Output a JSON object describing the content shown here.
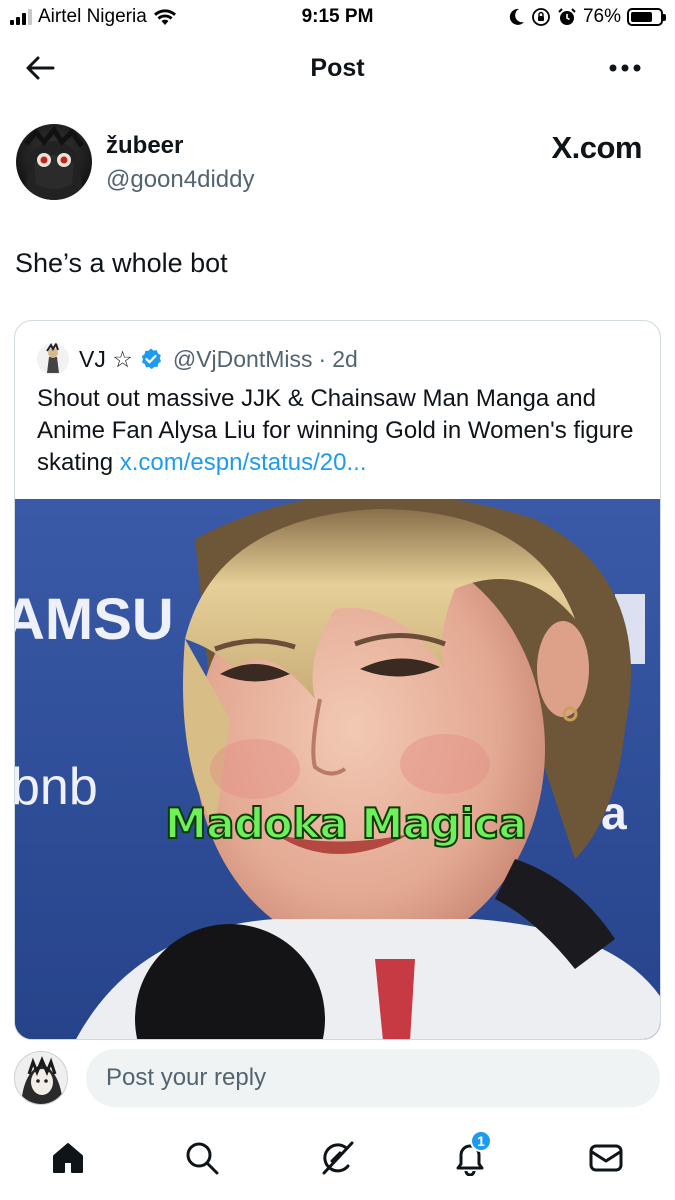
{
  "status_bar": {
    "carrier": "Airtel Nigeria",
    "time": "9:15 PM",
    "battery_percent": "76%",
    "battery_level": 0.76
  },
  "header": {
    "title": "Post"
  },
  "post": {
    "author_name": "žubeer",
    "author_handle": "@goon4diddy",
    "source_label": "X.com",
    "text": "She’s a whole bot"
  },
  "quote": {
    "name": "VJ ☆",
    "handle": "@VjDontMiss",
    "separator": "·",
    "age": "2d",
    "text": "Shout out massive JJK & Chainsaw Man Manga and Anime Fan Alysa Liu for winning Gold in Women's figure skating ",
    "link": "x.com/espn/status/20...",
    "media": {
      "caption": "Madoka Magica",
      "backdrop_words": [
        "AMSU",
        "bnb",
        "ba"
      ]
    }
  },
  "reply": {
    "placeholder": "Post your reply"
  },
  "tab_bar": {
    "notifications_badge": "1"
  },
  "colors": {
    "accent": "#1d9bf0",
    "secondary_text": "#536471",
    "caption_green": "#6ef05a"
  }
}
